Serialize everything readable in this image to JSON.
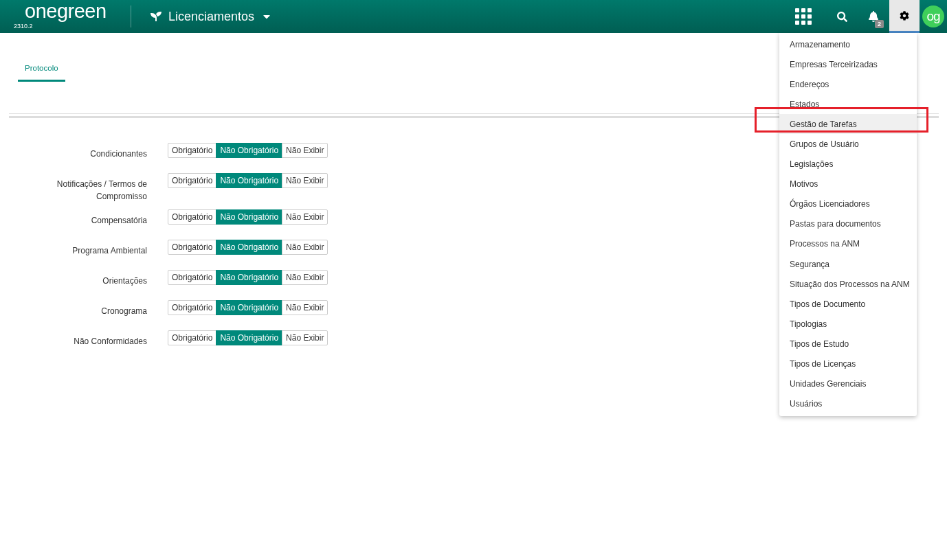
{
  "header": {
    "logo": "one**green**",
    "version": "2310.2",
    "module": "Licenciamentos",
    "notifications": "2",
    "avatar": "og",
    "settings_open": true
  },
  "tabs": [
    {
      "label": "Protocolo",
      "selected": true
    }
  ],
  "fields": [
    {
      "label": "Condicionantes",
      "options": [
        {
          "label": "Obrigatório",
          "selected": false
        },
        {
          "label": "Não Obrigatório",
          "selected": true
        },
        {
          "label": "Não Exibir",
          "selected": false
        }
      ]
    },
    {
      "label": "Notificações / Termos de Compromisso",
      "options": [
        {
          "label": "Obrigatório",
          "selected": false
        },
        {
          "label": "Não Obrigatório",
          "selected": true
        },
        {
          "label": "Não Exibir",
          "selected": false
        }
      ]
    },
    {
      "label": "Compensatória",
      "options": [
        {
          "label": "Obrigatório",
          "selected": false
        },
        {
          "label": "Não Obrigatório",
          "selected": true
        },
        {
          "label": "Não Exibir",
          "selected": false
        }
      ]
    },
    {
      "label": "Programa Ambiental",
      "options": [
        {
          "label": "Obrigatório",
          "selected": false
        },
        {
          "label": "Não Obrigatório",
          "selected": true
        },
        {
          "label": "Não Exibir",
          "selected": false
        }
      ]
    },
    {
      "label": "Orientações",
      "options": [
        {
          "label": "Obrigatório",
          "selected": false
        },
        {
          "label": "Não Obrigatório",
          "selected": true
        },
        {
          "label": "Não Exibir",
          "selected": false
        }
      ]
    },
    {
      "label": "Cronograma",
      "options": [
        {
          "label": "Obrigatório",
          "selected": false
        },
        {
          "label": "Não Obrigatório",
          "selected": true
        },
        {
          "label": "Não Exibir",
          "selected": false
        }
      ]
    },
    {
      "label": "Não Conformidades",
      "options": [
        {
          "label": "Obrigatório",
          "selected": false
        },
        {
          "label": "Não Obrigatório",
          "selected": true
        },
        {
          "label": "Não Exibir",
          "selected": false
        }
      ]
    }
  ],
  "settings_menu": [
    {
      "label": "Armazenamento",
      "selected": false
    },
    {
      "label": "Empresas Terceirizadas",
      "selected": false
    },
    {
      "label": "Endereços",
      "selected": false
    },
    {
      "label": "Estados",
      "selected": false
    },
    {
      "label": "Gestão de Tarefas",
      "selected": true
    },
    {
      "label": "Grupos de Usuário",
      "selected": false
    },
    {
      "label": "Legislações",
      "selected": false
    },
    {
      "label": "Motivos",
      "selected": false
    },
    {
      "label": "Órgãos Licenciadores",
      "selected": false
    },
    {
      "label": "Pastas para documentos",
      "selected": false
    },
    {
      "label": "Processos na ANM",
      "selected": false
    },
    {
      "label": "Segurança",
      "selected": false
    },
    {
      "label": "Situação dos Processos na ANM",
      "selected": false
    },
    {
      "label": "Tipos de Documento",
      "selected": false
    },
    {
      "label": "Tipologias",
      "selected": false
    },
    {
      "label": "Tipos de Estudo",
      "selected": false
    },
    {
      "label": "Tipos de Licenças",
      "selected": false
    },
    {
      "label": "Unidades Gerenciais",
      "selected": false
    },
    {
      "label": "Usuários",
      "selected": false
    }
  ]
}
